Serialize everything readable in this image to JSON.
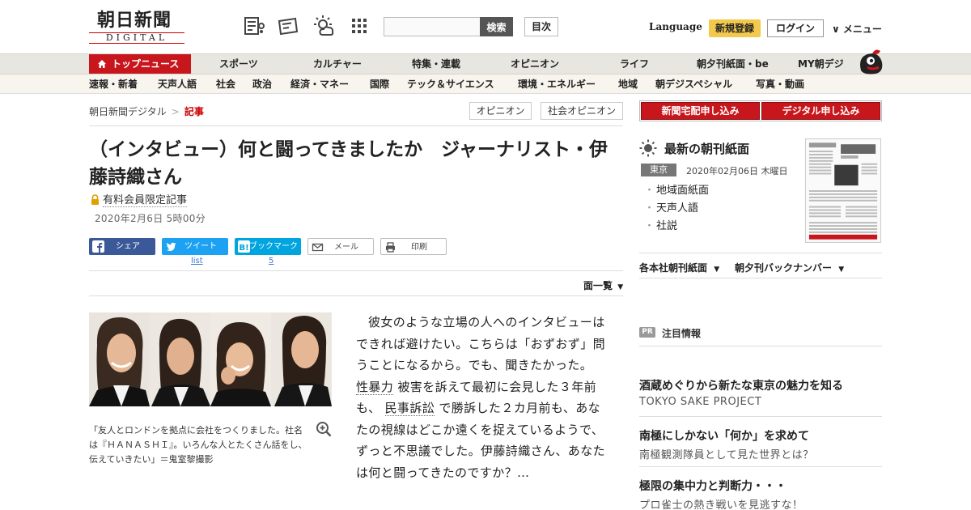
{
  "header": {
    "logo_jp": "朝日新聞",
    "logo_en": "DIGITAL",
    "search_button": "検索",
    "mokuji_button": "目次",
    "language": "Language",
    "register": "新規登録",
    "login": "ログイン",
    "menu": "∨ メニュー"
  },
  "nav_primary": [
    "トップニュース",
    "スポーツ",
    "カルチャー",
    "特集・連載",
    "オピニオン",
    "ライフ",
    "朝夕刊紙面・be",
    "MY朝デジ"
  ],
  "nav_secondary": [
    "速報・新着",
    "天声人語",
    "社会",
    "政治",
    "経済・マネー",
    "国際",
    "テック＆サイエンス",
    "環境・エネルギー",
    "地域",
    "朝デジスペシャル",
    "写真・動画"
  ],
  "breadcrumb": {
    "home": "朝日新聞デジタル",
    "separator": ">",
    "current": "記事"
  },
  "tags": [
    "オピニオン",
    "社会オピニオン"
  ],
  "article": {
    "title": "（インタビュー）何と闘ってきましたか　ジャーナリスト・伊藤詩織さん",
    "premium_label": "有料会員限定記事",
    "date": "2020年2月6日 5時00分",
    "caption": "「友人とロンドンを拠点に会社をつくりました。社名は『ＨＡＮＡＳＨＩ』。いろんな人とたくさん話をし、伝えていきたい」＝鬼室黎撮影",
    "body_parts": [
      "彼女のような立場の人へのインタビューはできれば避けたい。こちらは「おずおず」問うことになるから。でも、聞きたかった。",
      "性暴力",
      "被害を訴えて最初に会見した３年前も、",
      "民事訴訟",
      "で勝訴した２カ月前も、あなたの視線はどこか遠くを捉えているようで、ずっと不思議でした。伊藤詩織さん、あなたは何と闘ってきたのですか？…"
    ],
    "menki": "面一覧"
  },
  "share": {
    "facebook": "シェア",
    "twitter": "ツイート",
    "twitter_count": "list",
    "hatena": "ブックマーク",
    "hatena_count": "5",
    "mail": "メール",
    "print": "印刷"
  },
  "sidebar": {
    "cta_home": "新聞宅配申し込み",
    "cta_digital": "デジタル申し込み",
    "latest_title": "最新の朝刊紙面",
    "edition": "東京",
    "edition_date": "2020年02月06日 木曜日",
    "links": [
      "地域面紙面",
      "天声人語",
      "社説"
    ],
    "dropdown_branch": "各本社朝刊紙面",
    "dropdown_backnumber": "朝夕刊バックナンバー",
    "pr_badge": "PR",
    "pr_title": "注目情報",
    "promos": [
      {
        "title": "酒蔵めぐりから新たな東京の魅力を知る",
        "sub": "TOKYO SAKE PROJECT"
      },
      {
        "title": "南極にしかない「何か」を求めて",
        "sub": "南極観測隊員として見た世界とは？"
      },
      {
        "title": "極限の集中力と判断力・・・",
        "sub": "プロ雀士の熱き戦いを見逃すな！"
      }
    ]
  },
  "colors": {
    "brand_red": "#c8161d",
    "facebook": "#3b5998",
    "twitter": "#1da1f2",
    "hatena": "#00a4de",
    "register_yellow": "#f2c94c"
  }
}
